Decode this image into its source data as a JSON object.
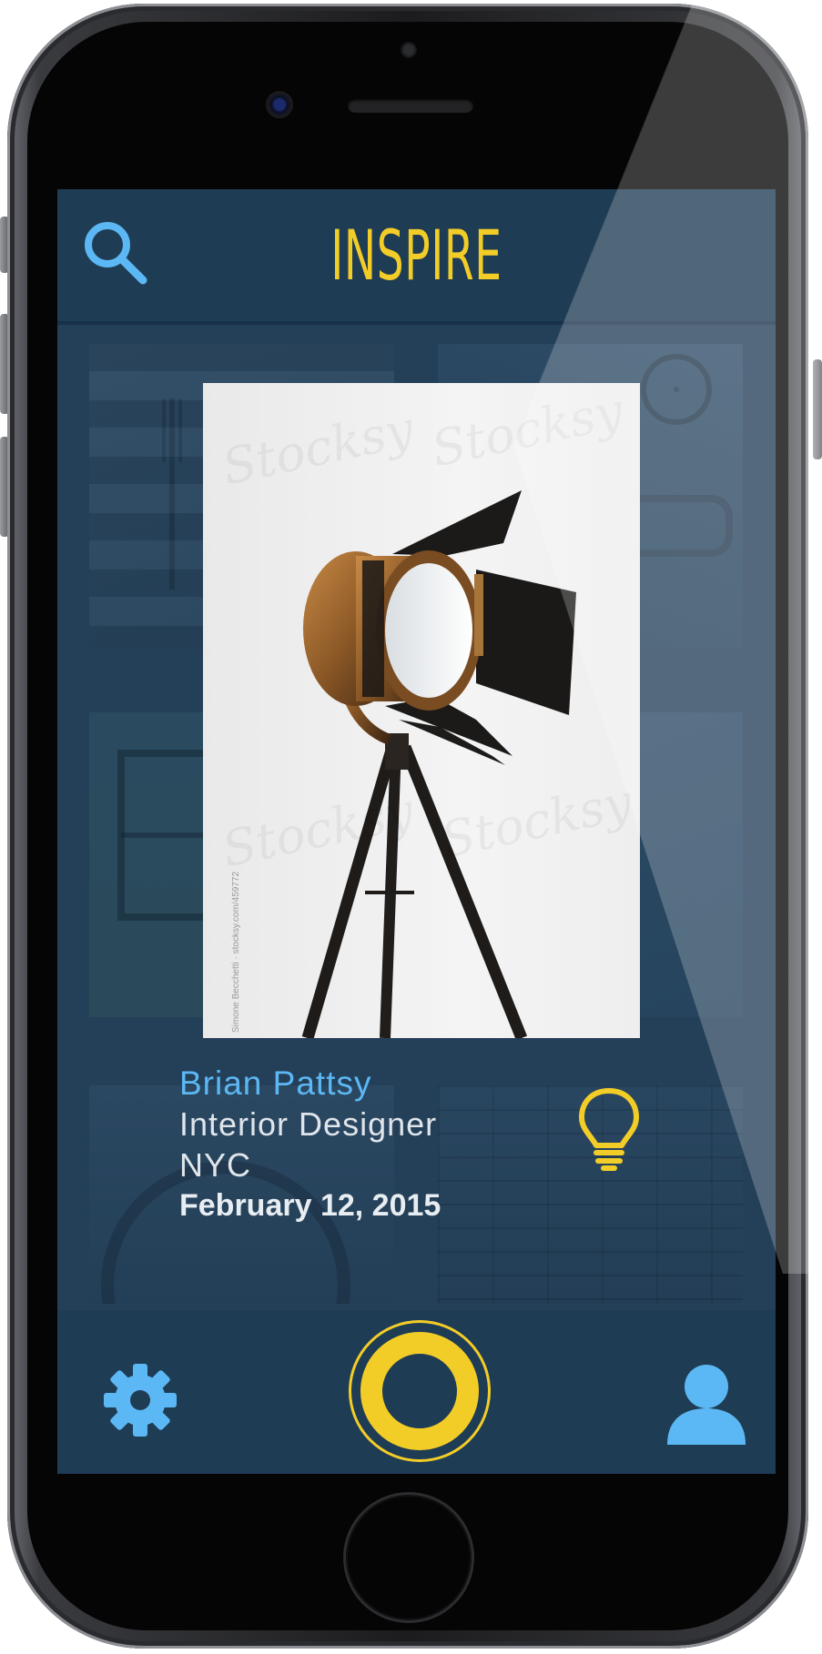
{
  "app": {
    "title": "INSPIRE"
  },
  "photo": {
    "watermark": "Stocksy",
    "credit": "Simone Becchetti · stocksy.com/459772"
  },
  "post": {
    "name": "Brian Pattsy",
    "role": "Interior Designer",
    "city": "NYC",
    "date": "February 12, 2015"
  },
  "icons": {
    "search": "search-icon",
    "idea": "lightbulb-icon",
    "settings": "gear-icon",
    "capture": "capture-ring-icon",
    "profile": "user-icon"
  },
  "colors": {
    "accent": "#f3cd27",
    "highlight": "#5cb8f4",
    "screen_bg": "#243f58",
    "bar_bg": "#1f3c55",
    "text": "#dfe5ea"
  }
}
